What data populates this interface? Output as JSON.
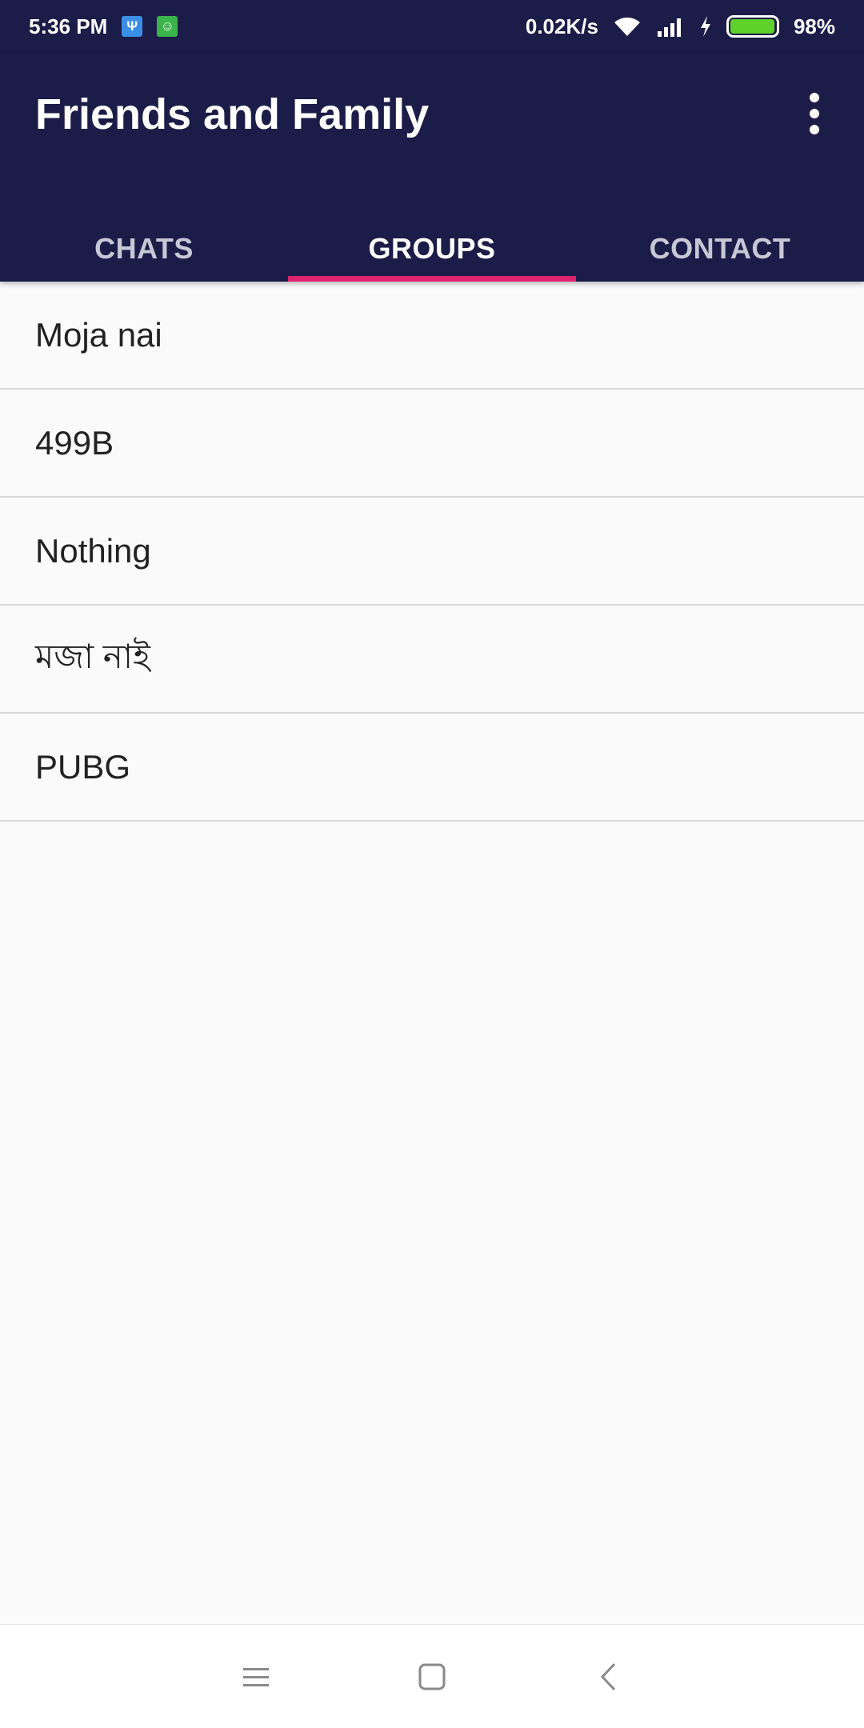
{
  "status_bar": {
    "time": "5:36 PM",
    "notification_icons": [
      "usb-icon",
      "android-icon"
    ],
    "network_speed": "0.02K/s",
    "battery_percent": "98%",
    "battery_level": 0.98,
    "icons": [
      "wifi-icon",
      "signal-icon",
      "charging-icon",
      "battery-icon"
    ]
  },
  "app_bar": {
    "title": "Friends and Family",
    "menu_icon": "more-vert-icon"
  },
  "tabs": [
    {
      "label": "CHATS",
      "active": false
    },
    {
      "label": "GROUPS",
      "active": true
    },
    {
      "label": "CONTACT",
      "active": false
    }
  ],
  "groups": [
    {
      "name": "Moja nai"
    },
    {
      "name": "499B"
    },
    {
      "name": "Nothing"
    },
    {
      "name": "মজা নাই"
    },
    {
      "name": "PUBG"
    }
  ],
  "nav_bar": {
    "buttons": [
      "menu-icon",
      "home-icon",
      "back-icon"
    ]
  },
  "colors": {
    "primary": "#1c1c48",
    "accent": "#e0246c",
    "background": "#fafafa",
    "battery": "#5fd12a"
  }
}
